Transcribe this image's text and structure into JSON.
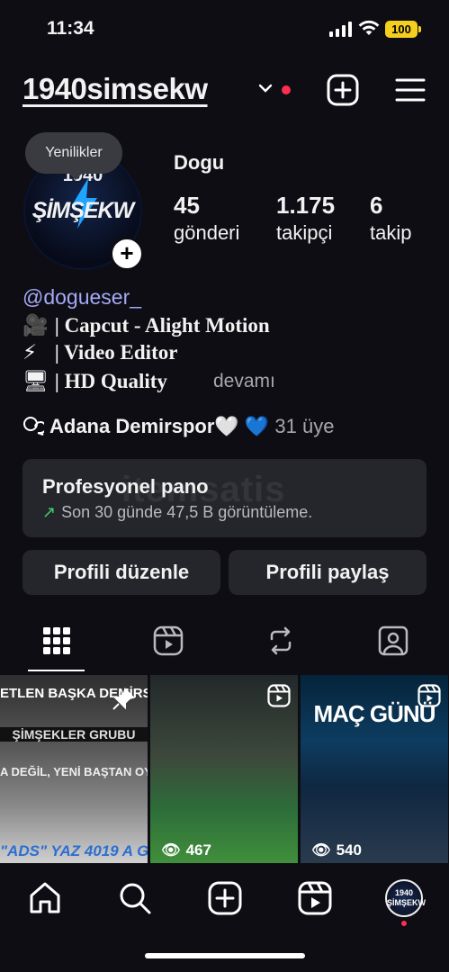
{
  "status": {
    "time": "11:34",
    "battery": "100"
  },
  "header": {
    "username": "1940simsekw"
  },
  "profile": {
    "tooltip": "Yenilikler",
    "avatar_year": "1940",
    "avatar_name": "ŞİMŞEKW",
    "display_name": "Dogu",
    "stats": [
      {
        "value": "45",
        "label": "gönderi"
      },
      {
        "value": "1.175",
        "label": "takipçi"
      },
      {
        "value": "6",
        "label": "takip"
      }
    ],
    "handle": "@dogueser_",
    "bio": [
      {
        "emoji": "🎥",
        "text": "| Capcut - Alight Motion"
      },
      {
        "emoji": "⚡",
        "text": "| Video Editor"
      },
      {
        "emoji": "🖥",
        "text": "| HD Quality"
      }
    ],
    "more": "devamı",
    "community": {
      "name": "Adana Demirspor🤍 💙",
      "members": "31 üye"
    }
  },
  "dashboard": {
    "title": "Profesyonel pano",
    "subtitle": "Son 30 günde 47,5 B görüntüleme.",
    "watermark": "itemsatis"
  },
  "buttons": {
    "edit": "Profili düzenle",
    "share": "Profili paylaş"
  },
  "grid": [
    {
      "text_top": "ETLEN BAŞKA DEMİRSPOR",
      "text_mid": "ŞİMŞEKLER GRUBU",
      "text_low": "A DEĞİL, YENİ BAŞTAN OY",
      "text_bottom": "\"ADS\" YAZ 4019 A G",
      "views": ""
    },
    {
      "views": "467"
    },
    {
      "text_top": "MAÇ GÜNÜ",
      "views": "540"
    }
  ],
  "colors": {
    "background": "#0d0d13",
    "card": "#25262c",
    "accent_link": "#a6aaf6",
    "notification": "#ff2d4f",
    "battery": "#f5cf1d"
  }
}
